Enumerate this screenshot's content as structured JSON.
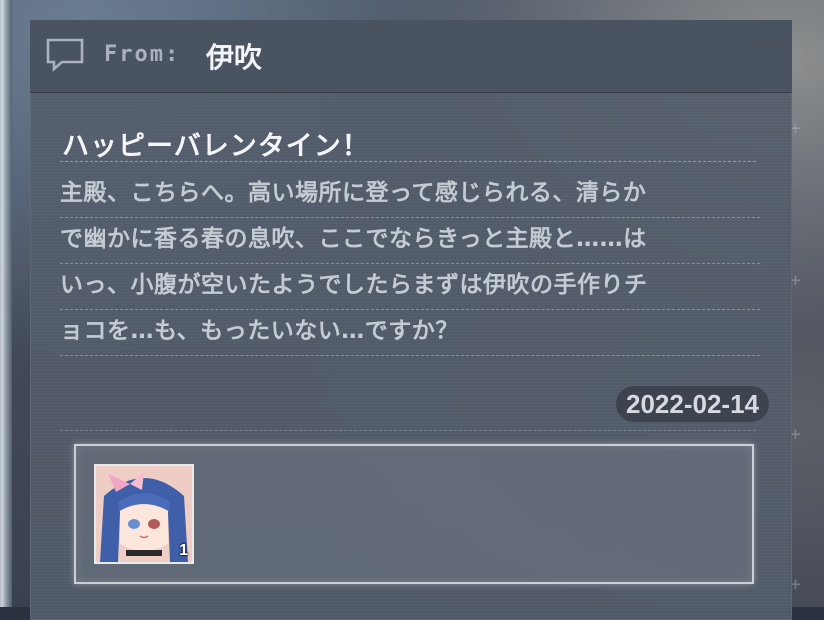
{
  "header": {
    "from_label": "From:",
    "sender": "伊吹",
    "icon": "chat-bubble-icon"
  },
  "message": {
    "title": "ハッピーバレンタイン！",
    "lines": [
      "主殿、こちらへ。高い場所に登って感じられる、清らか",
      "で幽かに香る春の息吹、ここでならきっと主殿と……は",
      "いっ、小腹が空いたようでしたらまずは伊吹の手作りチ",
      "ョコを…も、もったいない…ですか？"
    ],
    "date": "2022-02-14"
  },
  "attachment": {
    "item_name": "ship-portrait-ibuki",
    "count": "1"
  },
  "colors": {
    "panel": "#545c6a",
    "header": "#4a5260",
    "title_text": "#f4f5f7",
    "body_text": "#c5cbd3",
    "badge_bg": "#3e444f"
  }
}
